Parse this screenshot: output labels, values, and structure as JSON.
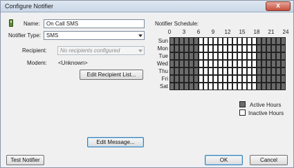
{
  "window": {
    "title": "Configure Notifier",
    "close_label": "x"
  },
  "form": {
    "name_label": "Name:",
    "name_value": "On Call SMS",
    "type_label": "Notifier Type:",
    "type_value": "SMS",
    "recipient_label": "Recipient:",
    "recipient_value": "No recipients configured",
    "modem_label": "Modem:",
    "modem_value": "<Unknown>",
    "edit_recipient_button": "Edit Recipient List...",
    "edit_message_button": "Edit Message..."
  },
  "schedule": {
    "label": "Notifier Schedule:",
    "hour_labels": [
      "0",
      "3",
      "6",
      "9",
      "12",
      "15",
      "18",
      "21",
      "24"
    ],
    "days": [
      "Sun",
      "Mon",
      "Tue",
      "Wed",
      "Thu",
      "Fri",
      "Sat"
    ],
    "active_hours_start": 6,
    "active_hours_end": 18,
    "active_color": "#6b6b6b",
    "inactive_color": "#ffffff",
    "legend_active": "Active Hours",
    "legend_inactive": "Inactive Hours"
  },
  "footer": {
    "test_button": "Test Notifier",
    "ok_button": "OK",
    "cancel_button": "Cancel"
  }
}
